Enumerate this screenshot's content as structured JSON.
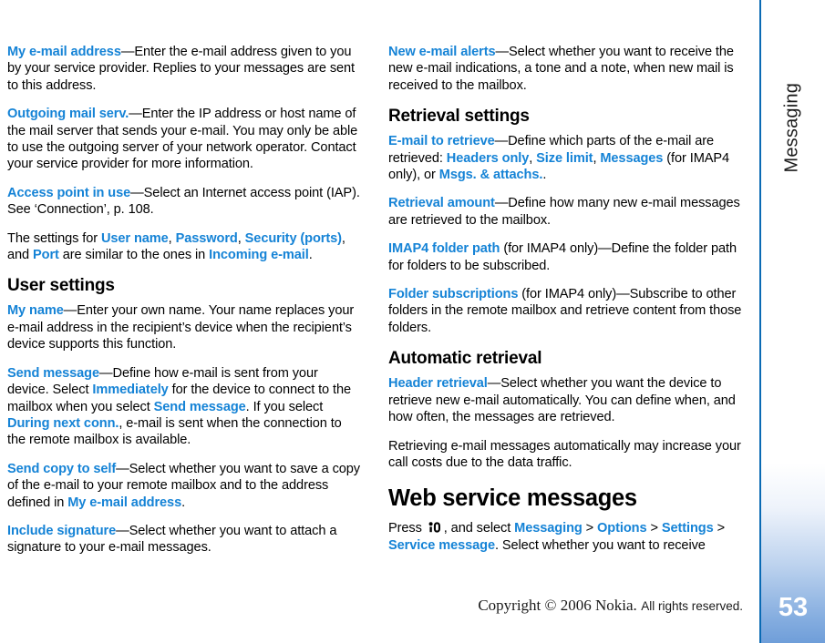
{
  "chapter": {
    "label": "Messaging"
  },
  "page_number": "53",
  "footer": {
    "copyright_serif": "Copyright © 2006 Nokia.",
    "copyright_sans": "All rights reserved."
  },
  "colors": {
    "keyword_blue": "#1583d6",
    "rule_blue": "#0a6ab4",
    "tab_gradient_end": "#6f9ed9"
  },
  "left_column": {
    "blocks": [
      {
        "type": "paragraph",
        "id": "my-email-address",
        "runs": [
          {
            "t": "kw",
            "text": "My e-mail address"
          },
          {
            "t": "plain",
            "text": "—Enter the e-mail address given to you by your service provider. Replies to your messages are sent to this address."
          }
        ]
      },
      {
        "type": "paragraph",
        "id": "outgoing-mail-serv",
        "runs": [
          {
            "t": "kw",
            "text": "Outgoing mail serv."
          },
          {
            "t": "plain",
            "text": "—Enter the IP address or host name of the mail server that sends your e-mail. You may only be able to use the outgoing server of your network operator. Contact your service provider for more information."
          }
        ]
      },
      {
        "type": "paragraph",
        "id": "access-point-in-use",
        "runs": [
          {
            "t": "kw",
            "text": "Access point in use"
          },
          {
            "t": "plain",
            "text": "—Select an Internet access point (IAP). See ‘Connection’, p. 108."
          }
        ]
      },
      {
        "type": "paragraph",
        "id": "settings-similar",
        "runs": [
          {
            "t": "plain",
            "text": "The settings for "
          },
          {
            "t": "kw",
            "text": "User name"
          },
          {
            "t": "plain",
            "text": ", "
          },
          {
            "t": "kw",
            "text": "Password"
          },
          {
            "t": "plain",
            "text": ", "
          },
          {
            "t": "kw",
            "text": "Security (ports)"
          },
          {
            "t": "plain",
            "text": ", and "
          },
          {
            "t": "kw",
            "text": "Port"
          },
          {
            "t": "plain",
            "text": " are similar to the ones in "
          },
          {
            "t": "kw",
            "text": "Incoming e-mail"
          },
          {
            "t": "plain",
            "text": "."
          }
        ]
      },
      {
        "type": "heading",
        "id": "user-settings",
        "text": "User settings"
      },
      {
        "type": "paragraph",
        "id": "my-name",
        "runs": [
          {
            "t": "kw",
            "text": "My name"
          },
          {
            "t": "plain",
            "text": "—Enter your own name. Your name replaces your e-mail address in the recipient’s device when the recipient’s device supports this function."
          }
        ]
      },
      {
        "type": "paragraph",
        "id": "send-message",
        "runs": [
          {
            "t": "kw",
            "text": "Send message"
          },
          {
            "t": "plain",
            "text": "—Define how e-mail is sent from your device. Select "
          },
          {
            "t": "kw",
            "text": "Immediately"
          },
          {
            "t": "plain",
            "text": " for the device to connect to the mailbox when you select "
          },
          {
            "t": "kw",
            "text": "Send message"
          },
          {
            "t": "plain",
            "text": ". If you select "
          },
          {
            "t": "kw",
            "text": "During next conn."
          },
          {
            "t": "plain",
            "text": ", e-mail is sent when the connection to the remote mailbox is available."
          }
        ]
      },
      {
        "type": "paragraph",
        "id": "send-copy-to-self",
        "runs": [
          {
            "t": "kw",
            "text": "Send copy to self"
          },
          {
            "t": "plain",
            "text": "—Select whether you want to save a copy of the e-mail to your remote mailbox and to the address defined in "
          },
          {
            "t": "kw",
            "text": "My e-mail address"
          },
          {
            "t": "plain",
            "text": "."
          }
        ]
      },
      {
        "type": "paragraph",
        "id": "include-signature",
        "runs": [
          {
            "t": "kw",
            "text": "Include signature"
          },
          {
            "t": "plain",
            "text": "—Select whether you want to attach a signature to your e-mail messages."
          }
        ]
      }
    ]
  },
  "right_column": {
    "blocks": [
      {
        "type": "paragraph",
        "id": "new-email-alerts",
        "runs": [
          {
            "t": "kw",
            "text": "New e-mail alerts"
          },
          {
            "t": "plain",
            "text": "—Select whether you want to receive the new e-mail indications, a tone and a note, when new mail is received to the mailbox."
          }
        ]
      },
      {
        "type": "heading",
        "id": "retrieval-settings",
        "text": "Retrieval settings"
      },
      {
        "type": "paragraph",
        "id": "email-to-retrieve",
        "runs": [
          {
            "t": "kw",
            "text": "E-mail to retrieve"
          },
          {
            "t": "plain",
            "text": "—Define which parts of the e-mail are retrieved: "
          },
          {
            "t": "kw",
            "text": "Headers only"
          },
          {
            "t": "plain",
            "text": ", "
          },
          {
            "t": "kw",
            "text": "Size limit"
          },
          {
            "t": "plain",
            "text": ", "
          },
          {
            "t": "kw",
            "text": "Messages"
          },
          {
            "t": "plain",
            "text": " (for IMAP4 only), or "
          },
          {
            "t": "kw",
            "text": "Msgs. & attachs."
          },
          {
            "t": "plain",
            "text": "."
          }
        ]
      },
      {
        "type": "paragraph",
        "id": "retrieval-amount",
        "runs": [
          {
            "t": "kw",
            "text": "Retrieval amount"
          },
          {
            "t": "plain",
            "text": "—Define how many new e-mail messages are retrieved to the mailbox."
          }
        ]
      },
      {
        "type": "paragraph",
        "id": "imap4-folder-path",
        "runs": [
          {
            "t": "kw",
            "text": "IMAP4 folder path"
          },
          {
            "t": "plain",
            "text": " (for IMAP4 only)—Define the folder path for folders to be subscribed."
          }
        ]
      },
      {
        "type": "paragraph",
        "id": "folder-subscriptions",
        "runs": [
          {
            "t": "kw",
            "text": "Folder subscriptions"
          },
          {
            "t": "plain",
            "text": " (for IMAP4 only)—Subscribe to other folders in the remote mailbox and retrieve content from those folders."
          }
        ]
      },
      {
        "type": "heading",
        "id": "automatic-retrieval",
        "text": "Automatic retrieval"
      },
      {
        "type": "paragraph",
        "id": "header-retrieval",
        "runs": [
          {
            "t": "kw",
            "text": "Header retrieval"
          },
          {
            "t": "plain",
            "text": "—Select whether you want the device to retrieve new e-mail automatically. You can define when, and how often, the messages are retrieved."
          }
        ]
      },
      {
        "type": "paragraph",
        "id": "retrieving-costs",
        "runs": [
          {
            "t": "plain",
            "text": "Retrieving e-mail messages automatically may increase your call costs due to the data traffic."
          }
        ]
      },
      {
        "type": "heading-big",
        "id": "web-service-messages",
        "text": "Web service messages"
      },
      {
        "type": "paragraph",
        "id": "press-menu-key",
        "runs": [
          {
            "t": "plain",
            "text": "Press "
          },
          {
            "t": "icon",
            "text": "menu-key-icon"
          },
          {
            "t": "plain",
            "text": ", and select "
          },
          {
            "t": "kw",
            "text": "Messaging"
          },
          {
            "t": "plain",
            "text": " > "
          },
          {
            "t": "kw",
            "text": "Options"
          },
          {
            "t": "plain",
            "text": " > "
          },
          {
            "t": "kw",
            "text": "Settings"
          },
          {
            "t": "plain",
            "text": " > "
          },
          {
            "t": "kw",
            "text": "Service message"
          },
          {
            "t": "plain",
            "text": ". Select whether you want to receive"
          }
        ]
      }
    ]
  }
}
